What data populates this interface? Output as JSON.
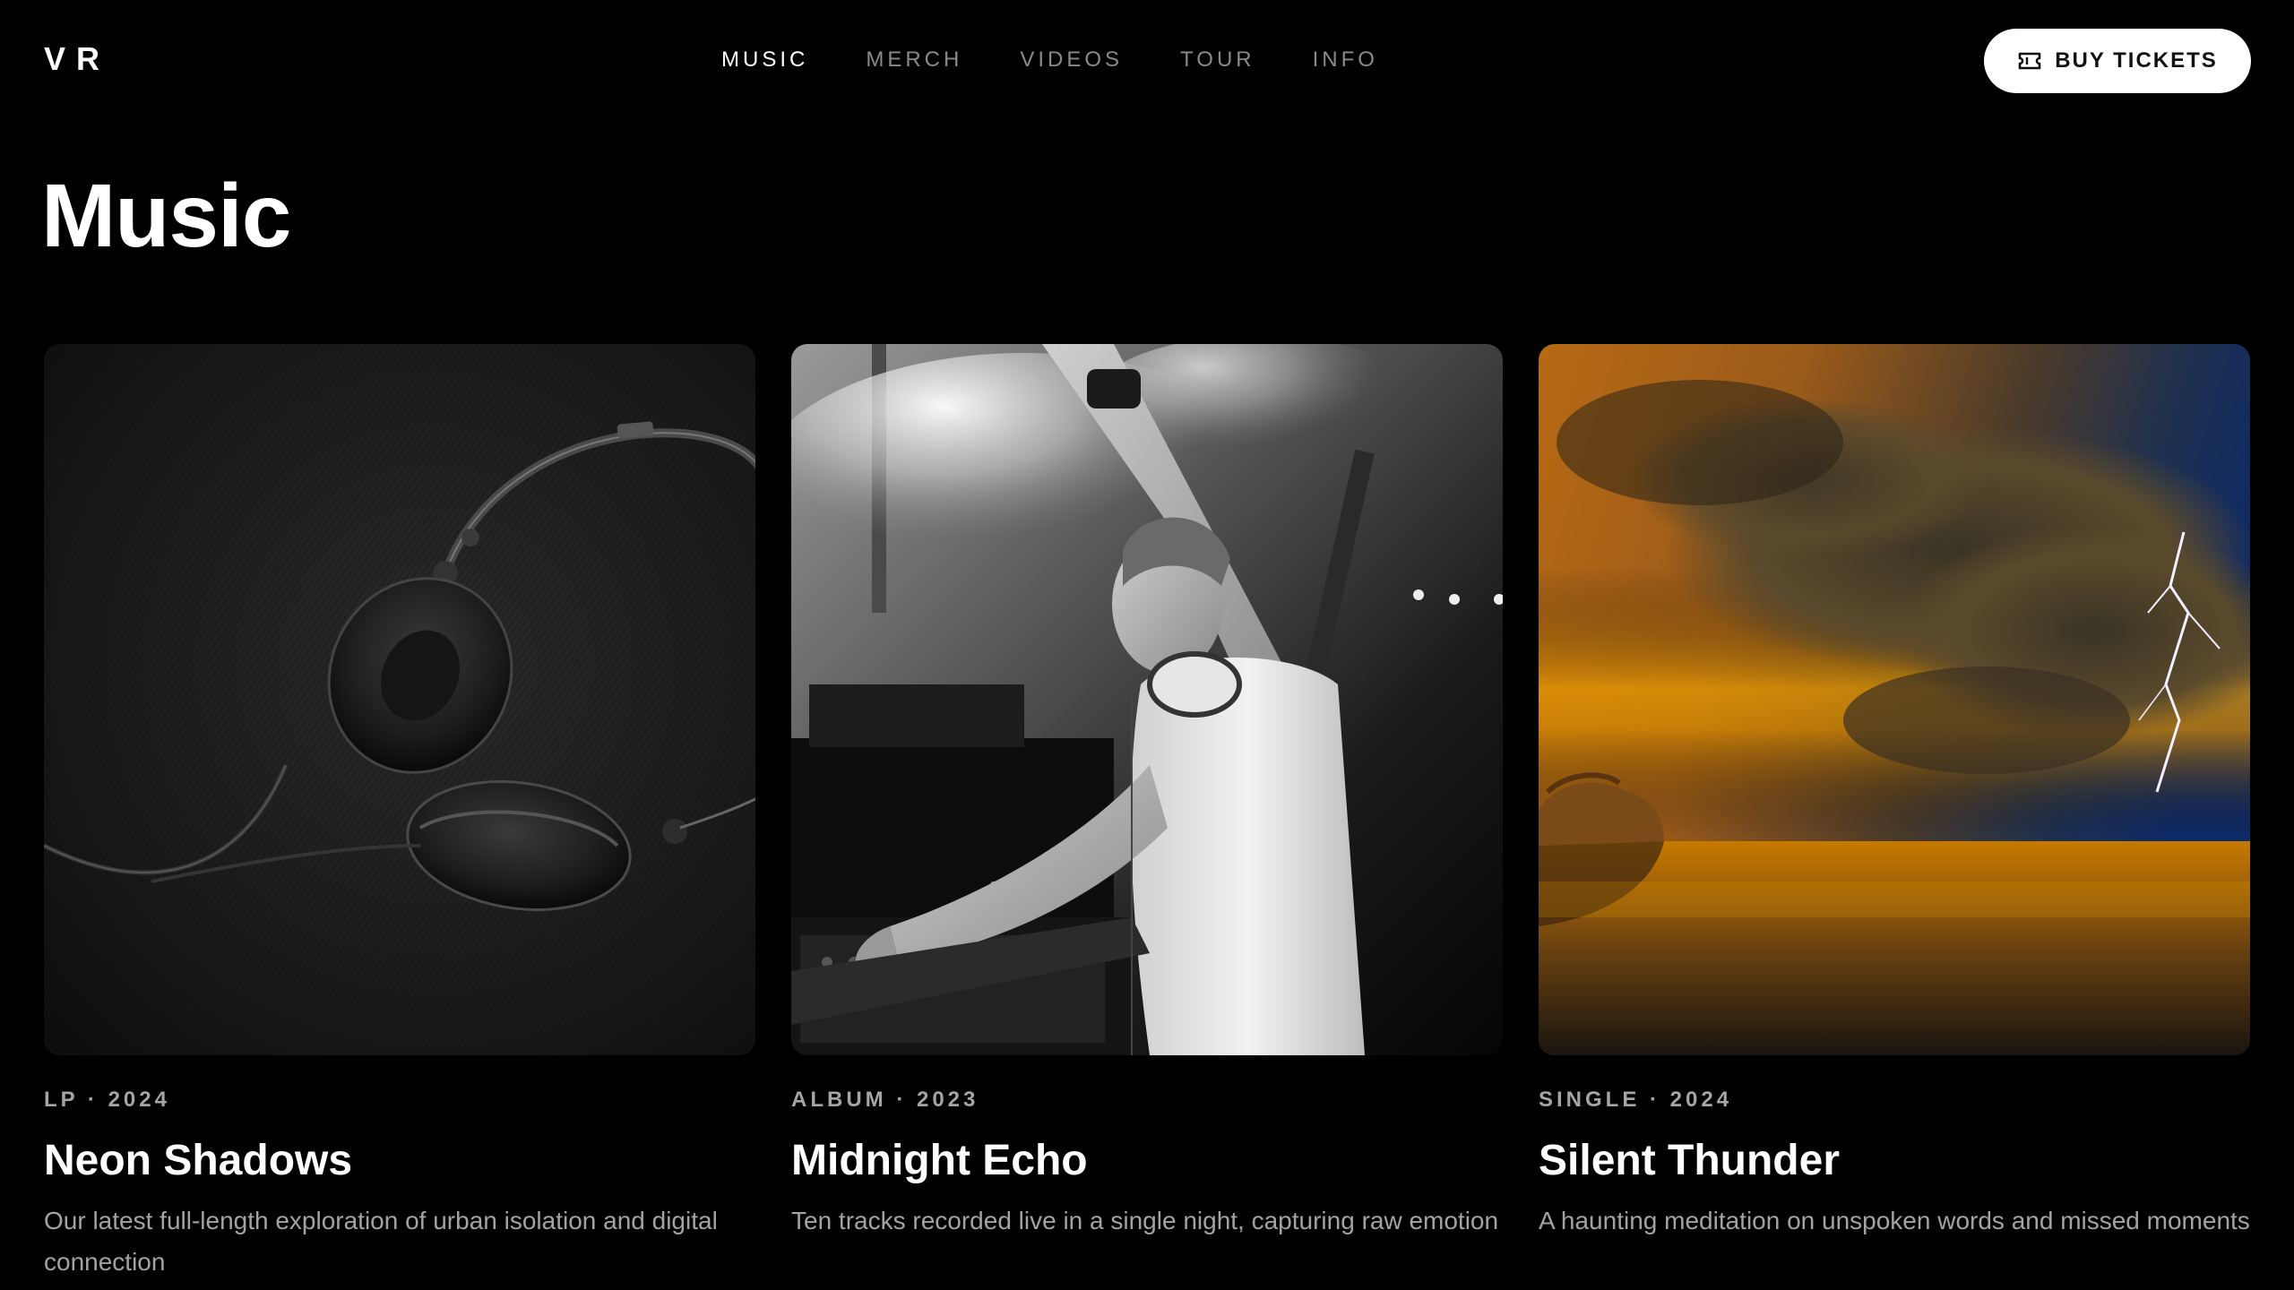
{
  "header": {
    "logo": "VR",
    "nav": [
      {
        "label": "MUSIC",
        "active": true
      },
      {
        "label": "MERCH",
        "active": false
      },
      {
        "label": "VIDEOS",
        "active": false
      },
      {
        "label": "TOUR",
        "active": false
      },
      {
        "label": "INFO",
        "active": false
      }
    ],
    "cta": {
      "label": "BUY TICKETS",
      "icon": "ticket-icon"
    }
  },
  "page": {
    "title": "Music"
  },
  "releases": [
    {
      "meta": "LP · 2024",
      "title": "Neon Shadows",
      "description": "Our latest full-length exploration of urban isolation and digital connection",
      "cover": "headphones-photo"
    },
    {
      "meta": "ALBUM · 2023",
      "title": "Midnight Echo",
      "description": "Ten tracks recorded live in a single night, capturing raw emotion",
      "cover": "dj-performer-photo"
    },
    {
      "meta": "SINGLE · 2024",
      "title": "Silent Thunder",
      "description": "A haunting meditation on unspoken words and missed moments",
      "cover": "storm-sunset-photo"
    }
  ],
  "colors": {
    "background": "#000000",
    "text": "#ffffff",
    "muted": "#8a8a8a",
    "button_bg": "#ffffff"
  }
}
